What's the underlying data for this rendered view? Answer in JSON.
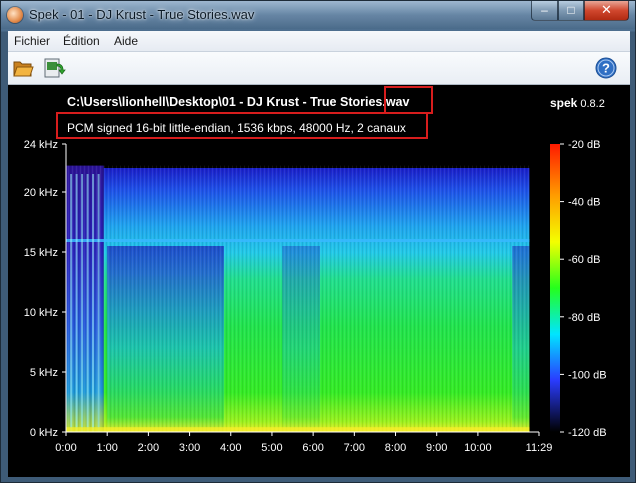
{
  "window": {
    "title": "Spek - 01 - DJ Krust - True Stories.wav",
    "controls": {
      "minimize": "–",
      "maximize": "□",
      "close": "✕"
    }
  },
  "menu": {
    "items": [
      "Fichier",
      "Édition",
      "Aide"
    ]
  },
  "toolbar": {
    "icons": [
      "open-folder-icon",
      "save-image-icon",
      "help-icon"
    ]
  },
  "spectrum": {
    "file_path": "C:\\Users\\lionhell\\Desktop\\01 - DJ Krust - True Stories.wav",
    "file_info": "PCM signed 16-bit little-endian, 1536 kbps, 48000 Hz, 2 canaux",
    "brand_name": "spek",
    "brand_version": "0.8.2",
    "freq_ticks": [
      "24 kHz",
      "20 kHz",
      "15 kHz",
      "10 kHz",
      "5 kHz",
      "0 kHz"
    ],
    "freq_values": [
      24,
      20,
      15,
      10,
      5,
      0
    ],
    "time_ticks": [
      "0:00",
      "1:00",
      "2:00",
      "3:00",
      "4:00",
      "5:00",
      "6:00",
      "7:00",
      "8:00",
      "9:00",
      "10:00",
      "11:29"
    ],
    "time_seconds": [
      0,
      60,
      120,
      180,
      240,
      300,
      360,
      420,
      480,
      540,
      600,
      689
    ],
    "db_ticks": [
      "-20 dB",
      "-40 dB",
      "-60 dB",
      "-80 dB",
      "-100 dB",
      "-120 dB"
    ],
    "db_values": [
      -20,
      -40,
      -60,
      -80,
      -100,
      -120
    ],
    "duration_seconds": 689,
    "max_freq_khz": 24
  }
}
